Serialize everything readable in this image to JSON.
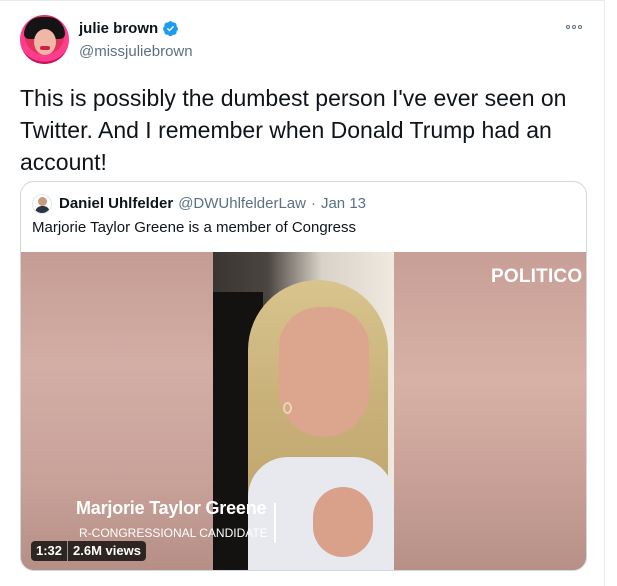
{
  "author": {
    "display_name": "julie brown",
    "handle": "@missjuliebrown"
  },
  "tweet": {
    "text": "This is possibly the dumbest person I've ever seen on Twitter. And I remember when Donald Trump had an account!"
  },
  "quoted_tweet": {
    "display_name": "Daniel Uhlfelder",
    "handle": "@DWUhlfelderLaw",
    "separator": "·",
    "date": "Jan 13",
    "text": "Marjorie Taylor Greene is a member of Congress",
    "video": {
      "watermark": "POLITICO",
      "lower_third_name": "Marjorie Taylor Greene",
      "lower_third_title": "R-CONGRESSIONAL CANDIDATE",
      "duration": "1:32",
      "views": "2.6M views"
    }
  },
  "icons": {
    "verified": "verified-badge-icon",
    "more": "more-options-icon"
  },
  "colors": {
    "verified_blue": "#1d9bf0",
    "secondary_text": "#5b7083",
    "border": "#cfd9de"
  }
}
